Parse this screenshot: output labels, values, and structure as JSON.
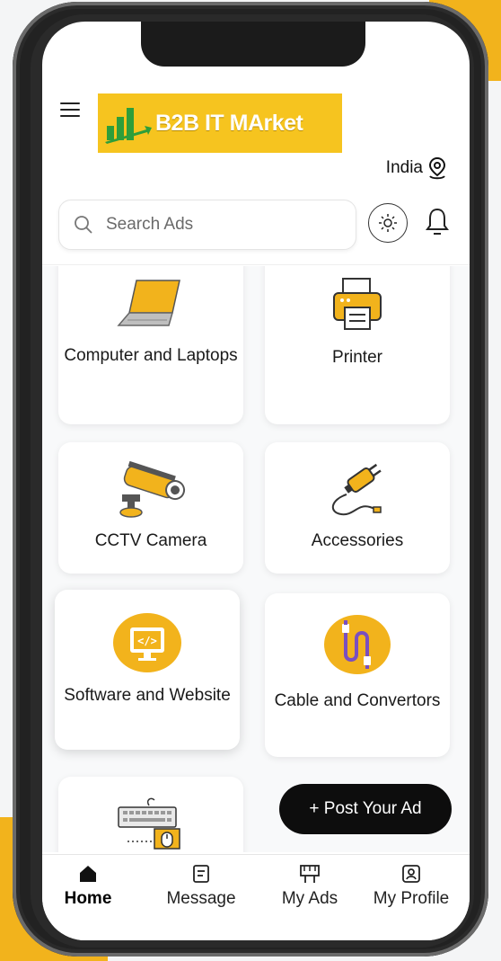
{
  "brand": {
    "name": "B2B IT MArket",
    "color": "#f6c41f"
  },
  "header": {
    "location": "India"
  },
  "search": {
    "placeholder": "Search Ads"
  },
  "categories": [
    {
      "label": "Computer and Laptops",
      "icon": "laptop-icon"
    },
    {
      "label": "Printer",
      "icon": "printer-icon"
    },
    {
      "label": "CCTV Camera",
      "icon": "cctv-camera-icon"
    },
    {
      "label": "Accessories",
      "icon": "plug-cable-icon"
    },
    {
      "label": "Software and Website",
      "icon": "monitor-code-icon"
    },
    {
      "label": "Cable and Convertors",
      "icon": "cable-icon"
    },
    {
      "label": "",
      "icon": "keyboard-mouse-icon"
    }
  ],
  "actions": {
    "post_ad": "+ Post Your Ad"
  },
  "bottom_nav": [
    {
      "label": "Home",
      "icon": "home-icon",
      "active": true
    },
    {
      "label": "Message",
      "icon": "message-icon",
      "active": false
    },
    {
      "label": "My Ads",
      "icon": "ads-board-icon",
      "active": false
    },
    {
      "label": "My Profile",
      "icon": "profile-icon",
      "active": false
    }
  ]
}
